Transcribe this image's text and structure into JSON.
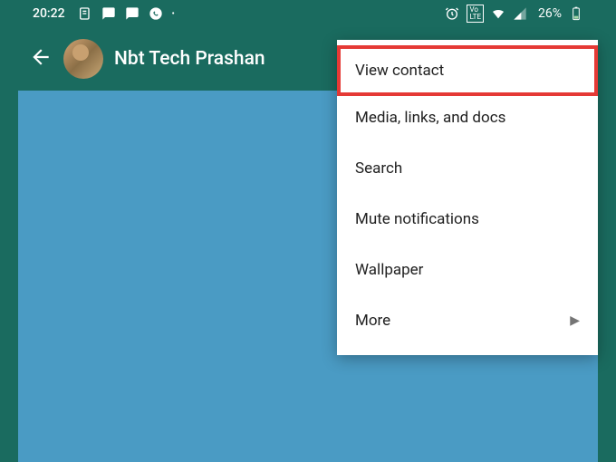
{
  "statusbar": {
    "time": "20:22",
    "battery_text": "26%"
  },
  "appbar": {
    "contact_name": "Nbt Tech Prashan"
  },
  "menu": {
    "items": [
      {
        "label": "View contact",
        "highlighted": true,
        "has_submenu": false
      },
      {
        "label": "Media, links, and docs",
        "highlighted": false,
        "has_submenu": false
      },
      {
        "label": "Search",
        "highlighted": false,
        "has_submenu": false
      },
      {
        "label": "Mute notifications",
        "highlighted": false,
        "has_submenu": false
      },
      {
        "label": "Wallpaper",
        "highlighted": false,
        "has_submenu": false
      },
      {
        "label": "More",
        "highlighted": false,
        "has_submenu": true
      }
    ]
  }
}
